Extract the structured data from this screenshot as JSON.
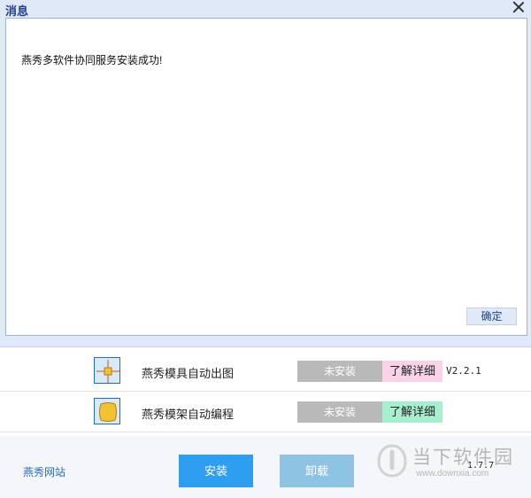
{
  "dialog": {
    "title": "消息",
    "message": "燕秀多软件协同服务安装成功!",
    "ok_label": "确定"
  },
  "products": [
    {
      "name": "燕秀模具自动出图",
      "status": "未安装",
      "detail_label": "了解详细",
      "detail_color": "#fbd3e9",
      "version": "V2.2.1",
      "icon": "mold-drawing-icon"
    },
    {
      "name": "燕秀模架自动编程",
      "status": "未安装",
      "detail_label": "了解详细",
      "detail_color": "#a7f0cf",
      "icon": "mold-base-programming-icon"
    }
  ],
  "footer": {
    "site_link": "燕秀网站",
    "install_label": "安装",
    "uninstall_label": "卸载",
    "version": "1.7.7"
  },
  "watermark": {
    "name": "当下软件园",
    "url": "www.downxia.com"
  },
  "colors": {
    "accent": "#2d9ef0",
    "accent_disabled": "#8ec3e4",
    "status_gray": "#b9b9b9",
    "link": "#2a6bb8"
  }
}
